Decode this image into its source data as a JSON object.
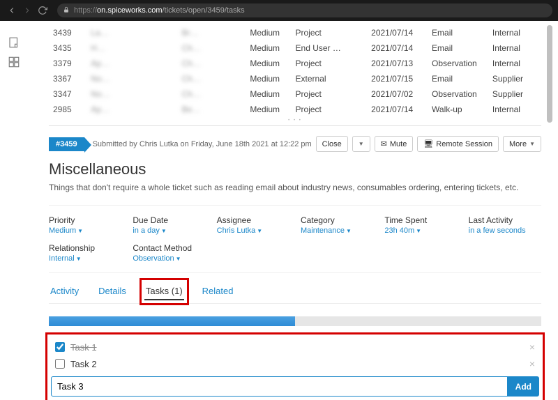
{
  "browser": {
    "url_domain": "on.spiceworks.com",
    "url_path": "/tickets/open/3459/tasks",
    "url_scheme": "https://"
  },
  "tickets": [
    {
      "id": "3439",
      "summary": "La…",
      "assignee": "Br…",
      "priority": "Medium",
      "category": "Project",
      "date": "2021/07/14",
      "source": "Email",
      "scope": "Internal"
    },
    {
      "id": "3435",
      "summary": "H…",
      "assignee": "Ch…",
      "priority": "Medium",
      "category": "End User …",
      "date": "2021/07/14",
      "source": "Email",
      "scope": "Internal"
    },
    {
      "id": "3379",
      "summary": "Ap…",
      "assignee": "Ch…",
      "priority": "Medium",
      "category": "Project",
      "date": "2021/07/13",
      "source": "Observation",
      "scope": "Internal"
    },
    {
      "id": "3367",
      "summary": "No…",
      "assignee": "Ch…",
      "priority": "Medium",
      "category": "External",
      "date": "2021/07/15",
      "source": "Email",
      "scope": "Supplier"
    },
    {
      "id": "3347",
      "summary": "No…",
      "assignee": "Ch…",
      "priority": "Medium",
      "category": "Project",
      "date": "2021/07/02",
      "source": "Observation",
      "scope": "Supplier"
    },
    {
      "id": "2985",
      "summary": "Ap…",
      "assignee": "Be…",
      "priority": "Medium",
      "category": "Project",
      "date": "2021/07/14",
      "source": "Walk-up",
      "scope": "Internal"
    }
  ],
  "detail": {
    "tag": "#3459",
    "submitted": "Submitted by Chris Lutka on Friday, June 18th 2021 at 12:22 pm",
    "buttons": {
      "close": "Close",
      "mute": "Mute",
      "remote": "Remote Session",
      "more": "More"
    },
    "title": "Miscellaneous",
    "description": "Things that don't require a whole ticket such as reading email about industry news, consumables ordering, entering tickets, etc."
  },
  "fields": {
    "priority": {
      "label": "Priority",
      "value": "Medium"
    },
    "due": {
      "label": "Due Date",
      "value": "in a day"
    },
    "assignee": {
      "label": "Assignee",
      "value": "Chris Lutka"
    },
    "category": {
      "label": "Category",
      "value": "Maintenance"
    },
    "time": {
      "label": "Time Spent",
      "value": "23h 40m"
    },
    "activity": {
      "label": "Last Activity",
      "value": "in a few seconds"
    },
    "relationship": {
      "label": "Relationship",
      "value": "Internal"
    },
    "contact": {
      "label": "Contact Method",
      "value": "Observation"
    }
  },
  "tabs": {
    "activity": "Activity",
    "details": "Details",
    "tasks": "Tasks (1)",
    "related": "Related"
  },
  "tasks": {
    "items": [
      {
        "label": "Task 1",
        "done": true
      },
      {
        "label": "Task 2",
        "done": false
      }
    ],
    "new": "Task 3",
    "add": "Add"
  }
}
